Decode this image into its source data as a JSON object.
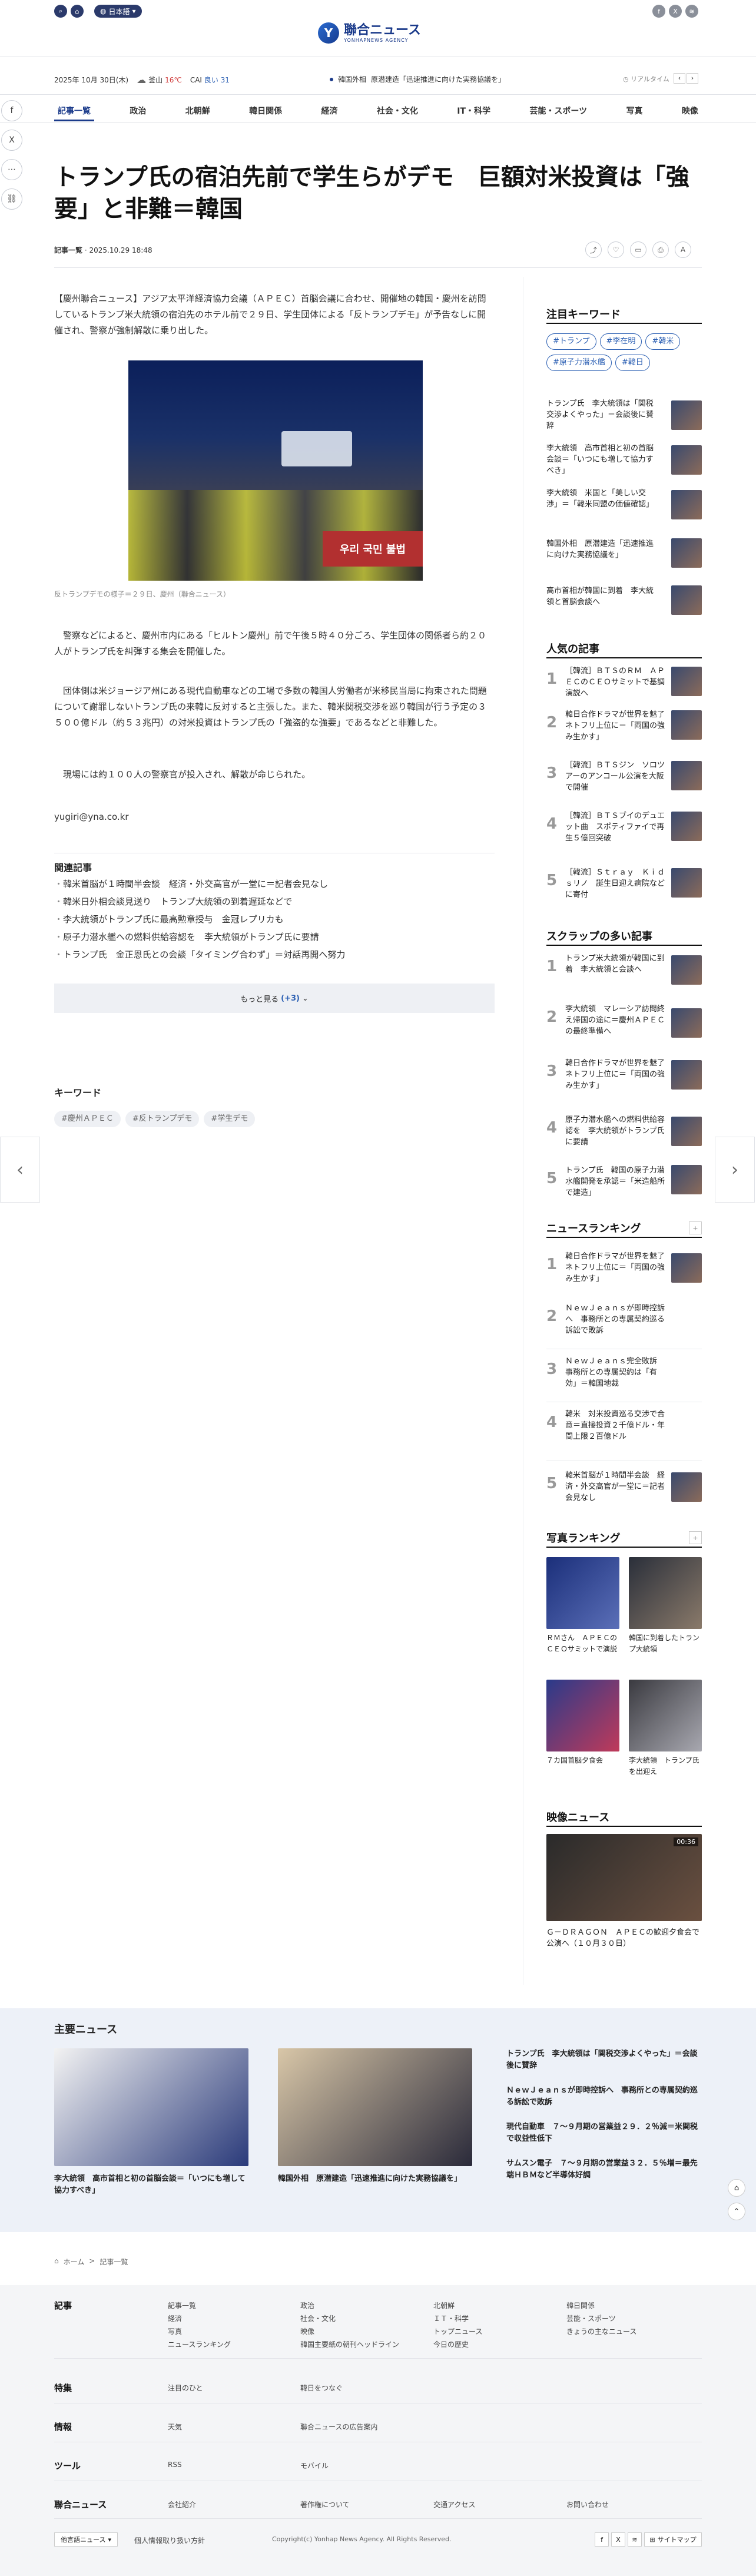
{
  "header": {
    "lang": "日本語",
    "logo_main": "聯合ニュース",
    "logo_sub": "YONHAPNEWS AGENCY",
    "date": "2025年 10月 30日(木)",
    "city": "釜山",
    "temp": "16℃",
    "cai_label": "CAI",
    "cai_value": "良い 31",
    "ticker_tag": "韓国外相",
    "ticker_text": "原潜建造「迅速推進に向けた実務協議を」",
    "realtime": "リアルタイム",
    "pager_prev": "‹",
    "pager_next": "›"
  },
  "nav": [
    "記事一覧",
    "政治",
    "北朝鮮",
    "韓日関係",
    "経済",
    "社会・文化",
    "IT・科学",
    "芸能・スポーツ",
    "写真",
    "映像"
  ],
  "article": {
    "title": "トランプ氏の宿泊先前で学生らがデモ　巨額対米投資は「強要」と非難＝韓国",
    "category": "記事一覧",
    "datetime": "2025.10.29 18:48",
    "lead": "【慶州聯合ニュース】アジア太平洋経済協力会議（ＡＰＥＣ）首脳会議に合わせ、開催地の韓国・慶州を訪問しているトランプ米大統領の宿泊先のホテル前で２９日、学生団体による「反トランプデモ」が予告なしに開催され、警察が強制解散に乗り出した。",
    "caption": "反トランプデモの様子＝２９日、慶州（聯合ニュース）",
    "p1": "　警察などによると、慶州市内にある「ヒルトン慶州」前で午後５時４０分ごろ、学生団体の関係者ら約２０人がトランプ氏を糾弾する集会を開催した。",
    "p2": "　団体側は米ジョージア州にある現代自動車などの工場で多数の韓国人労働者が米移民当局に拘束された問題について謝罪しないトランプ氏の来韓に反対すると主張した。また、韓米関税交渉を巡り韓国が行う予定の３５００億ドル（約５３兆円）の対米投資はトランプ氏の「強盗的な強要」であるなどと非難した。",
    "p3": "　現場には約１００人の警察官が投入され、解散が命じられた。",
    "email": "yugiri@yna.co.kr",
    "photo_banner": "우리 국민 불법"
  },
  "related": {
    "heading": "関連記事",
    "items": [
      "韓米首脳が１時間半会談　経済・外交高官が一堂に＝記者会見なし",
      "韓米日外相会談見送り　トランプ大統領の到着遅延などで",
      "李大統領がトランプ氏に最高勲章授与　金冠レプリカも",
      "原子力潜水艦への燃料供給容認を　李大統領がトランプ氏に要請",
      "トランプ氏　金正恩氏との会談「タイミング合わず」＝対話再開へ努力"
    ],
    "more": "もっと見る",
    "more_count": "(+3)"
  },
  "keywords": {
    "heading": "キーワード",
    "tags": [
      "#慶州ＡＰＥＣ",
      "#反トランプデモ",
      "#学生デモ"
    ]
  },
  "side_keywords": {
    "heading": "注目キーワード",
    "tags": [
      "#トランプ",
      "#李在明",
      "#韓米",
      "#原子力潜水艦",
      "#韓日"
    ],
    "items": [
      "トランプ氏　李大統領は「関税交渉よくやった」＝会談後に賛辞",
      "李大統領　高市首相と初の首脳会談＝「いつにも増して協力すべき」",
      "李大統領　米国と「美しい交渉」＝「韓米同盟の価値確認」",
      "韓国外相　原潜建造「迅速推進に向けた実務協議を」",
      "高市首相が韓国に到着　李大統領と首脳会談へ"
    ]
  },
  "popular": {
    "heading": "人気の記事",
    "items": [
      "［韓流］ＢＴＳのＲＭ　ＡＰＥＣのＣＥＯサミットで基調演説へ",
      "韓日合作ドラマが世界を魅了　ネトフリ上位に＝「両国の強み生かす」",
      "［韓流］ＢＴＳジン　ソロツアーのアンコール公演を大阪で開催",
      "［韓流］ＢＴＳブイのデュエット曲　スポティファイで再生５億回突破",
      "［韓流］Ｓｔｒａｙ　Ｋｉｄｓリノ　誕生日迎え病院などに寄付"
    ]
  },
  "scrap": {
    "heading": "スクラップの多い記事",
    "items": [
      "トランプ米大統領が韓国に到着　李大統領と会談へ",
      "李大統領　マレーシア訪問終え帰国の途に＝慶州ＡＰＥＣの最終準備へ",
      "韓日合作ドラマが世界を魅了　ネトフリ上位に＝「両国の強み生かす」",
      "原子力潜水艦への燃料供給容認を　李大統領がトランプ氏に要請",
      "トランプ氏　韓国の原子力潜水艦開発を承認＝「米造船所で建造」"
    ]
  },
  "ranking": {
    "heading": "ニュースランキング",
    "items": [
      "韓日合作ドラマが世界を魅了　ネトフリ上位に＝「両国の強み生かす」",
      "ＮｅｗＪｅａｎｓが即時控訴へ　事務所との専属契約巡る訴訟で敗訴",
      "ＮｅｗＪｅａｎｓ完全敗訴　事務所との専属契約は「有効」＝韓国地裁",
      "韓米　対米投資巡る交渉で合意＝直接投資２千億ドル・年間上限２百億ドル",
      "韓米首脳が１時間半会談　経済・外交高官が一堂に＝記者会見なし"
    ]
  },
  "photo_ranking": {
    "heading": "写真ランキング",
    "items": [
      "ＲＭさん　ＡＰＥＣのＣＥＯサミットで演説",
      "韓国に到着したトランプ大統領",
      "７カ国首脳夕食会",
      "李大統領　トランプ氏を出迎え"
    ]
  },
  "video": {
    "heading": "映像ニュース",
    "duration": "00:36",
    "caption": "Ｇ－ＤＲＡＧＯＮ　ＡＰＥＣの歓迎夕食会で公演へ（１０月３０日）"
  },
  "main_news": {
    "heading": "主要ニュース",
    "card1": "李大統領　高市首相と初の首脳会談＝「いつにも増して協力すべき」",
    "card2": "韓国外相　原潜建造「迅速推進に向けた実務協議を」",
    "list": [
      "トランプ氏　李大統領は「関税交渉よくやった」＝会談後に賛辞",
      "ＮｅｗＪｅａｎｓが即時控訴へ　事務所との専属契約巡る訴訟で敗訴",
      "現代自動車　７～９月期の営業益２９．２％減＝米関税で収益性低下",
      "サムスン電子　７～９月期の営業益３２．５％増＝最先端ＨＢＭなど半導体好調"
    ]
  },
  "breadcrumb": {
    "home": "ホーム",
    "sep": ">",
    "current": "記事一覧"
  },
  "footer": {
    "article_head": "記事",
    "article_links": [
      "記事一覧",
      "経済",
      "写真",
      "ニュースランキング",
      "政治",
      "社会・文化",
      "映像",
      "韓国主要紙の朝刊ヘッドライン",
      "北朝鮮",
      "ＩＴ・科学",
      "トップニュース",
      "今日の歴史",
      "韓日関係",
      "芸能・スポーツ",
      "きょうの主なニュース"
    ],
    "feature_head": "特集",
    "feature_links": [
      "注目のひと",
      "韓日をつなぐ"
    ],
    "info_head": "情報",
    "info_links": [
      "天気",
      "聯合ニュースの広告案内"
    ],
    "tool_head": "ツール",
    "tool_links": [
      "RSS",
      "モバイル"
    ],
    "yonhap_head": "聯合ニュース",
    "yonhap_links": [
      "会社紹介",
      "著作権について",
      "著作権について",
      "交通アクセス",
      "お問い合わせ"
    ],
    "sites": "他言語ニュース",
    "privacy": "個人情報取り扱い方針",
    "copyright": "Copyright(c) Yonhap News Agency. All Rights Reserved.",
    "sitemap": "サイトマップ"
  }
}
